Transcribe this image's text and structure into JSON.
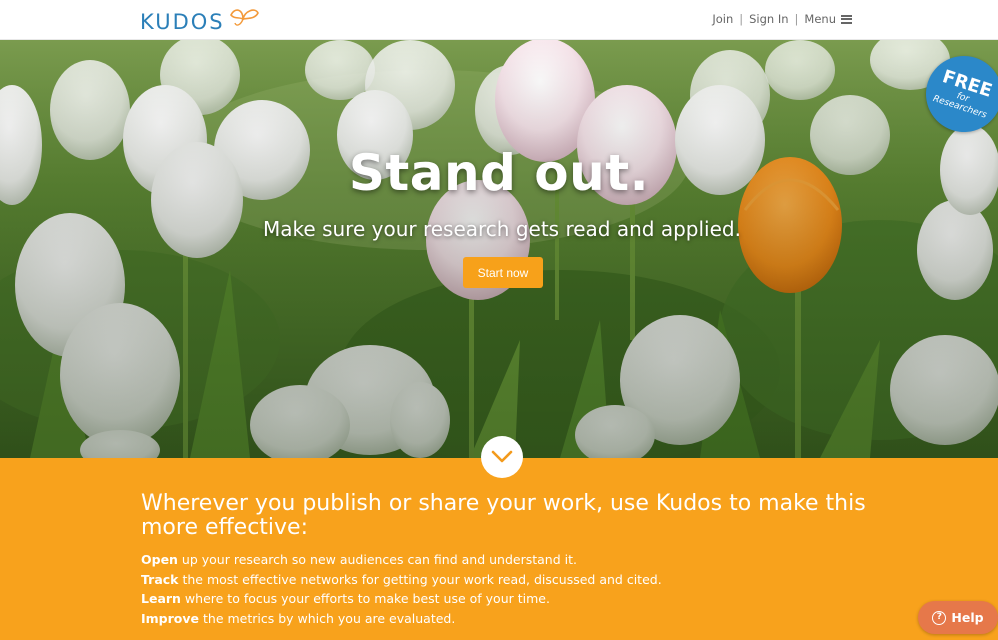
{
  "header": {
    "logo_text": "KUDOS",
    "nav": {
      "join": "Join",
      "separator": "|",
      "sign_in": "Sign In",
      "menu": "Menu"
    }
  },
  "hero": {
    "title": "Stand out.",
    "subtitle": "Make sure your research gets read and applied.",
    "cta_label": "Start now",
    "badge": {
      "line1": "FREE",
      "line2": "for",
      "line3": "Researchers"
    }
  },
  "info": {
    "heading": "Wherever you publish or share your work, use Kudos to make this more effective:",
    "items": [
      {
        "keyword": "Open",
        "text": " up your research so new audiences can find and understand it."
      },
      {
        "keyword": "Track",
        "text": " the most effective networks for getting your work read, discussed and cited."
      },
      {
        "keyword": "Learn",
        "text": " where to focus your efforts to make best use of your time."
      },
      {
        "keyword": "Improve",
        "text": " the metrics by which you are evaluated."
      }
    ]
  },
  "help": {
    "label": "Help",
    "icon_glyph": "?"
  },
  "icons": {
    "logo": "butterfly-icon",
    "menu": "hamburger-icon",
    "scroll": "chevron-down-icon",
    "help": "question-circle-icon"
  },
  "colors": {
    "brand_blue": "#2b7fb8",
    "accent_orange": "#f8a21c",
    "cta_orange": "#f7a11a",
    "badge_blue": "#2b88c9",
    "help_orange": "#e6784a"
  }
}
